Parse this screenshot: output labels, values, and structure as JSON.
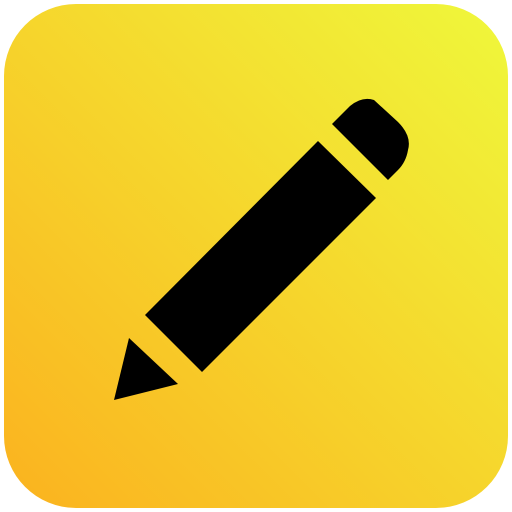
{
  "app_icon": {
    "icon": "pencil-icon",
    "colors": {
      "gradient_start": "#fbb21f",
      "gradient_mid": "#f6d52c",
      "gradient_end": "#eff83b",
      "glyph": "#000000"
    }
  }
}
